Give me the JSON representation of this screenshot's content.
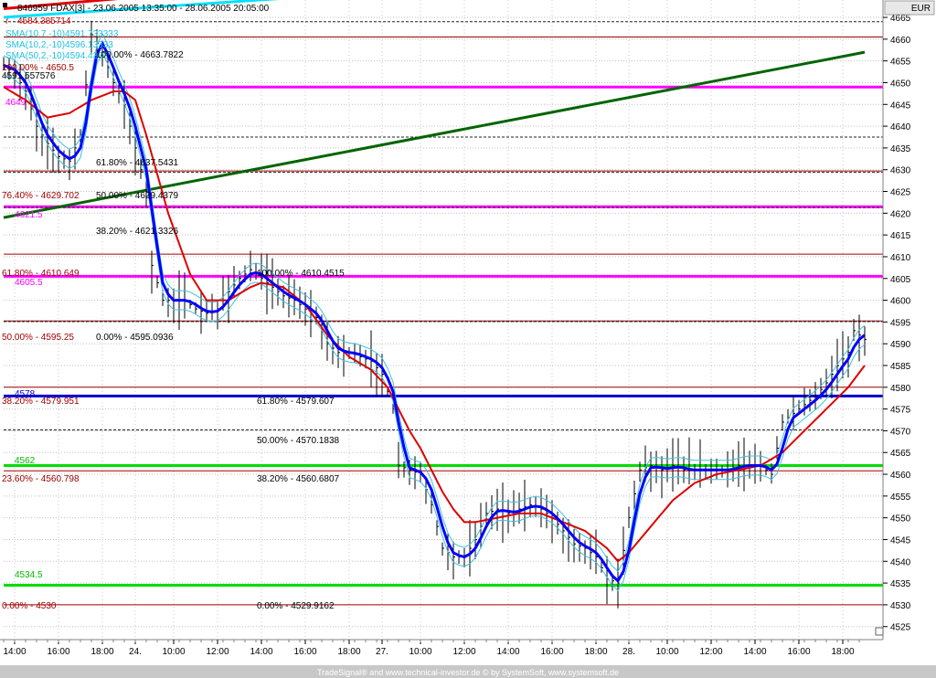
{
  "header": {
    "title": "846959  FDAX[3] - 23.06.2005 13:35:00 - 28.06.2005 20:05:00",
    "readout": "4584.385714",
    "legend_sma1": "SMA(10,7,-10)4591.733333",
    "legend_sma2": "SMA(10,2,-10)4596.13333",
    "legend_sma3": "SMA(50,2,-10)4594.4333"
  },
  "currency": "EUR",
  "footer": "TradeSignal® and www.technical-investor.de © by SystemSoft, www.systemsoft.de",
  "colors": {
    "price": "#000000",
    "sma_fast": "#0000ff",
    "sma_slow": "#dd0000",
    "bands": "#40c0e0",
    "trend_green": "#006400",
    "trend_red": "#e00000",
    "trend_cyan": "#00e0ff",
    "magenta": "#ff00ff",
    "lime": "#00dd00",
    "blue_level": "#0000cc",
    "fib_red": "#a00000"
  },
  "labels": {
    "fib_100_left": "100.00% - 4650.5",
    "fib_100_top": "100.00% - 4663.7822",
    "left_4591": "4591.557576",
    "magenta_4649": "4649",
    "fib_618_top": "61.80% - 4637.5431",
    "fib_764_left": "76.40% - 4629.702",
    "fib_50_top": "50.00% - 4629.4379",
    "magenta_4621": "4621.5",
    "fib_382_top": "38.20% - 4621.3326",
    "fib_618_left": "61.80% - 4610.649",
    "fib_100_mid": "100.00% - 4610.4515",
    "magenta_4605": "4605.5",
    "fib_50_left": "50.00% - 4595.25",
    "fib_0_top": "0.00% - 4595.0936",
    "blue_4578": "4578",
    "fib_382_left": "38.20% - 4579.951",
    "fib_618_mid": "61.80% - 4579.607",
    "fib_50_mid": "50.00% - 4570.1838",
    "green_4562": "4562",
    "fib_236_left": "23.60% - 4560.798",
    "fib_382_mid": "38.20% - 4560.6807",
    "green_4534": "4534.5",
    "fib_0_left": "0.00% - 4530",
    "fib_0_mid": "0.00% - 4529.9162"
  },
  "chart_data": {
    "type": "line",
    "title": "846959  FDAX[3] - 23.06.2005 13:35:00 - 28.06.2005 20:05:00",
    "currency": "EUR",
    "ylim": [
      4522,
      4669
    ],
    "y_ticks": [
      4525,
      4530,
      4535,
      4540,
      4545,
      4550,
      4555,
      4560,
      4565,
      4570,
      4575,
      4580,
      4585,
      4590,
      4595,
      4600,
      4605,
      4610,
      4615,
      4620,
      4625,
      4630,
      4635,
      4640,
      4645,
      4650,
      4655,
      4660,
      4665
    ],
    "x_ticks": [
      "14:00",
      "16:00",
      "18:00",
      "24.",
      "10:00",
      "12:00",
      "14:00",
      "16:00",
      "18:00",
      "27.",
      "10:00",
      "12:00",
      "14:00",
      "16:00",
      "18:00",
      "28.",
      "10:00",
      "12:00",
      "14:00",
      "16:00",
      "18:00"
    ],
    "x_tick_idx": [
      2,
      10,
      18,
      24,
      31,
      39,
      47,
      55,
      63,
      69,
      76,
      84,
      92,
      100,
      108,
      114,
      121,
      129,
      137,
      145,
      153
    ],
    "n_bars": 157,
    "price_knots": [
      [
        0,
        4654
      ],
      [
        2,
        4652
      ],
      [
        4,
        4648
      ],
      [
        6,
        4640
      ],
      [
        8,
        4636
      ],
      [
        10,
        4633
      ],
      [
        12,
        4632
      ],
      [
        14,
        4638
      ],
      [
        16,
        4661
      ],
      [
        18,
        4657
      ],
      [
        20,
        4650
      ],
      [
        22,
        4645
      ],
      [
        24,
        4635
      ],
      [
        26,
        4625
      ],
      [
        27,
        4608
      ],
      [
        29,
        4600
      ],
      [
        31,
        4600
      ],
      [
        33,
        4600
      ],
      [
        35,
        4598
      ],
      [
        37,
        4597
      ],
      [
        39,
        4598
      ],
      [
        41,
        4602
      ],
      [
        43,
        4605
      ],
      [
        45,
        4607
      ],
      [
        47,
        4605
      ],
      [
        49,
        4603
      ],
      [
        51,
        4601
      ],
      [
        53,
        4600
      ],
      [
        55,
        4598
      ],
      [
        57,
        4596
      ],
      [
        59,
        4590
      ],
      [
        61,
        4588
      ],
      [
        63,
        4588
      ],
      [
        65,
        4587
      ],
      [
        67,
        4586
      ],
      [
        69,
        4583
      ],
      [
        71,
        4575
      ],
      [
        72,
        4562
      ],
      [
        74,
        4561
      ],
      [
        76,
        4560
      ],
      [
        78,
        4553
      ],
      [
        80,
        4543
      ],
      [
        82,
        4541
      ],
      [
        84,
        4541
      ],
      [
        86,
        4545
      ],
      [
        88,
        4551
      ],
      [
        90,
        4552
      ],
      [
        92,
        4551
      ],
      [
        94,
        4552
      ],
      [
        96,
        4553
      ],
      [
        98,
        4552
      ],
      [
        100,
        4550
      ],
      [
        102,
        4547
      ],
      [
        104,
        4544
      ],
      [
        106,
        4543
      ],
      [
        108,
        4541
      ],
      [
        110,
        4536
      ],
      [
        112,
        4535
      ],
      [
        114,
        4550
      ],
      [
        116,
        4561
      ],
      [
        118,
        4562
      ],
      [
        120,
        4561
      ],
      [
        122,
        4562
      ],
      [
        124,
        4561
      ],
      [
        126,
        4561
      ],
      [
        128,
        4561
      ],
      [
        130,
        4561
      ],
      [
        132,
        4561
      ],
      [
        134,
        4562
      ],
      [
        136,
        4562
      ],
      [
        138,
        4562
      ],
      [
        140,
        4560
      ],
      [
        142,
        4572
      ],
      [
        144,
        4574
      ],
      [
        146,
        4576
      ],
      [
        148,
        4578
      ],
      [
        150,
        4581
      ],
      [
        152,
        4585
      ],
      [
        154,
        4588
      ],
      [
        155,
        4593
      ],
      [
        157,
        4591
      ]
    ],
    "sma_slow_knots": [
      [
        0,
        4649
      ],
      [
        4,
        4646
      ],
      [
        8,
        4642
      ],
      [
        12,
        4643
      ],
      [
        16,
        4646
      ],
      [
        20,
        4648
      ],
      [
        22,
        4648
      ],
      [
        24,
        4646
      ],
      [
        26,
        4638
      ],
      [
        30,
        4620
      ],
      [
        34,
        4606
      ],
      [
        37,
        4600
      ],
      [
        41,
        4600
      ],
      [
        45,
        4603
      ],
      [
        47,
        4604
      ],
      [
        51,
        4603
      ],
      [
        55,
        4599
      ],
      [
        59,
        4592
      ],
      [
        63,
        4587
      ],
      [
        67,
        4584
      ],
      [
        70,
        4580
      ],
      [
        72,
        4575
      ],
      [
        74,
        4570
      ],
      [
        76,
        4566
      ],
      [
        78,
        4561
      ],
      [
        80,
        4556
      ],
      [
        82,
        4552
      ],
      [
        84,
        4549
      ],
      [
        86,
        4549
      ],
      [
        90,
        4550
      ],
      [
        94,
        4551
      ],
      [
        98,
        4551
      ],
      [
        102,
        4549
      ],
      [
        106,
        4547
      ],
      [
        110,
        4543
      ],
      [
        112,
        4540
      ],
      [
        114,
        4542
      ],
      [
        118,
        4548
      ],
      [
        122,
        4554
      ],
      [
        126,
        4558
      ],
      [
        130,
        4560
      ],
      [
        134,
        4561
      ],
      [
        138,
        4562
      ],
      [
        142,
        4565
      ],
      [
        146,
        4570
      ],
      [
        150,
        4575
      ],
      [
        154,
        4580
      ],
      [
        157,
        4585
      ]
    ],
    "levels": [
      {
        "y": 4664,
        "style": "dashed-black"
      },
      {
        "y": 4660.5,
        "style": "red"
      },
      {
        "y": 4649,
        "style": "magenta"
      },
      {
        "y": 4637.5,
        "style": "dashed-black"
      },
      {
        "y": 4629.7,
        "style": "red"
      },
      {
        "y": 4629.4,
        "style": "dashed-black"
      },
      {
        "y": 4621.5,
        "style": "magenta"
      },
      {
        "y": 4621.3,
        "style": "dashed-black"
      },
      {
        "y": 4610.6,
        "style": "red"
      },
      {
        "y": 4605.5,
        "style": "magenta"
      },
      {
        "y": 4595.25,
        "style": "red"
      },
      {
        "y": 4595.1,
        "style": "dashed-black"
      },
      {
        "y": 4580,
        "style": "red"
      },
      {
        "y": 4578,
        "style": "blue"
      },
      {
        "y": 4570.2,
        "style": "dashed-black"
      },
      {
        "y": 4562,
        "style": "lime"
      },
      {
        "y": 4560.8,
        "style": "red"
      },
      {
        "y": 4534.5,
        "style": "lime"
      },
      {
        "y": 4530,
        "style": "red"
      }
    ],
    "trendlines": [
      {
        "color": "trend_green",
        "from": [
          0,
          4619
        ],
        "to": [
          157,
          4657
        ]
      },
      {
        "color": "trend_red",
        "from": [
          0,
          4667
        ],
        "to": [
          90,
          4677
        ]
      },
      {
        "color": "trend_cyan",
        "from": [
          0,
          4665
        ],
        "to": [
          140,
          4677
        ]
      }
    ]
  }
}
